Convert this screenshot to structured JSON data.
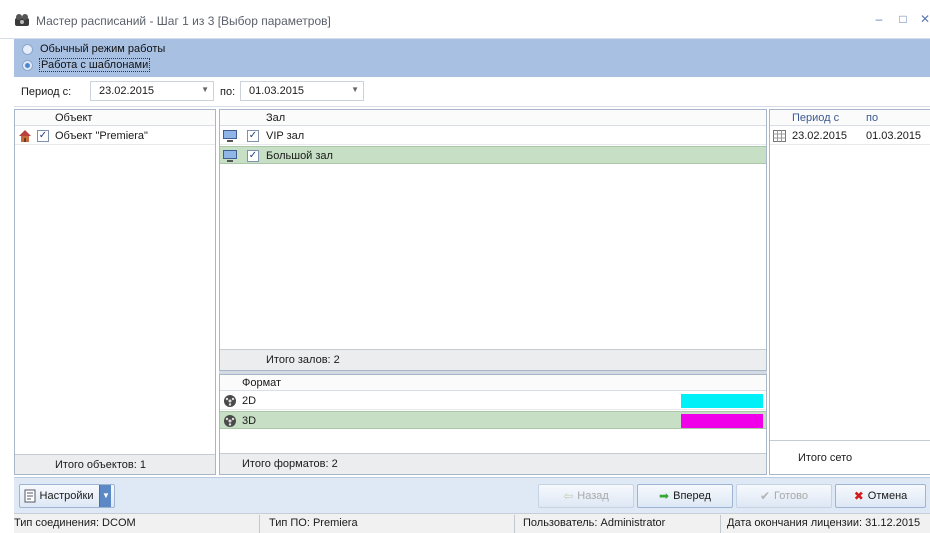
{
  "window": {
    "title": "Мастер расписаний - Шаг 1 из 3 [Выбор параметров]",
    "controls": {
      "minimize": "–",
      "maximize": "□",
      "close": "✕"
    }
  },
  "mode": {
    "options": [
      {
        "label": "Обычный режим работы",
        "checked": false
      },
      {
        "label": "Работа с шаблонами",
        "checked": true
      }
    ]
  },
  "period": {
    "from_label": "Период с:",
    "from_value": "23.02.2015",
    "to_label": "по:",
    "to_value": "01.03.2015"
  },
  "objects": {
    "header": "Объект",
    "rows": [
      {
        "label": "Объект \"Premiera\"",
        "checked": true
      }
    ],
    "footer": "Итого объектов: 1"
  },
  "halls": {
    "header": "Зал",
    "rows": [
      {
        "label": "VIP зал",
        "checked": true,
        "selected": false
      },
      {
        "label": "Большой зал",
        "checked": true,
        "selected": true
      }
    ],
    "footer": "Итого залов: 2"
  },
  "formats": {
    "header": "Формат",
    "rows": [
      {
        "label": "2D",
        "color": "#00f0f8",
        "selected": false
      },
      {
        "label": "3D",
        "color": "#f000e8",
        "selected": true
      }
    ],
    "footer": "Итого форматов: 2"
  },
  "grids": {
    "headers": {
      "from": "Период с",
      "to": "по"
    },
    "rows": [
      {
        "from": "23.02.2015",
        "to": "01.03.2015"
      }
    ],
    "footer": "Итого сето"
  },
  "buttons": {
    "settings": "Настройки",
    "back": "Назад",
    "next": "Вперед",
    "done": "Готово",
    "cancel": "Отмена"
  },
  "status": {
    "connection": "Тип соединения: DCOM",
    "software": "Тип ПО: Premiera",
    "user": "Пользователь: Administrator",
    "license": "Дата окончания лицензии: 31.12.2015"
  },
  "colors": {
    "mode_bar": "#a8c1e2",
    "selected_row": "#c6dfc5",
    "accent": "#4a84cf"
  }
}
